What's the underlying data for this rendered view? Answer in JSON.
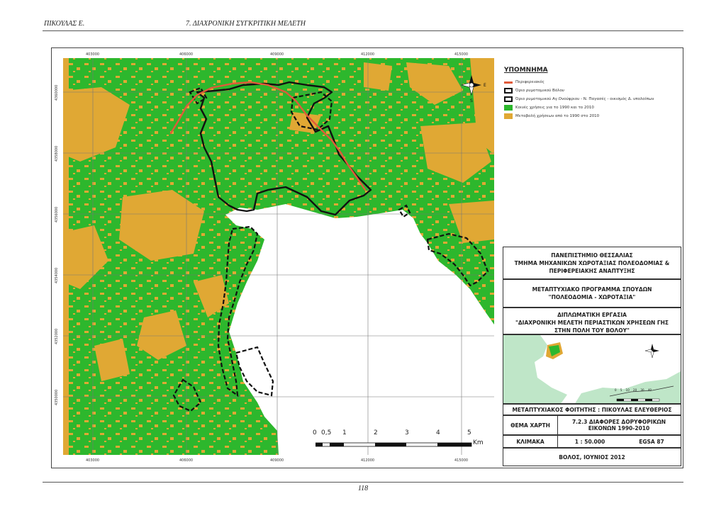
{
  "header": {
    "author": "ΠΙΚΟΥΛΑΣ Ε.",
    "chapter": "7. ΔΙΑΧΡΟΝΙΚΗ ΣΥΓΚΡΙΤΙΚΗ ΜΕΛΕΤΗ"
  },
  "footer": {
    "page_number": "118"
  },
  "map": {
    "x_ticks": [
      "403000",
      "406000",
      "409000",
      "412000",
      "415000"
    ],
    "y_ticks": [
      "4360000",
      "4358000",
      "4356000",
      "4354000",
      "4352000",
      "4350000"
    ],
    "colors": {
      "unchanged": "#2db72d",
      "changed": "#e0a834",
      "road": "#e05a3a",
      "boundary": "#111111",
      "sea": "#ffffff"
    }
  },
  "legend": {
    "title": "ΥΠΟΜΝΗΜΑ",
    "items": [
      {
        "label": "Περιφερειακός",
        "symbol": "line-red"
      },
      {
        "label": "Όριο ρυμοτομικού Βόλου",
        "symbol": "line-black"
      },
      {
        "label": "Όριο ρυμοτομικού Αγ.Ονούφριου - Ν. Παγασές - οικισμός Δ. υπολοίπων",
        "symbol": "dashed-black"
      },
      {
        "label": "Κοινές χρήσεις για το 1990 και το 2010",
        "symbol": "fill-green"
      },
      {
        "label": "Μεταβολή χρήσεων από το 1990 στο 2010",
        "symbol": "fill-orange"
      }
    ]
  },
  "north_arrow": {
    "n": "N",
    "e": "E",
    "s": "S",
    "w": "W"
  },
  "title_block": {
    "university": [
      "ΠΑΝΕΠΙΣΤΗΜΙΟ ΘΕΣΣΑΛΙΑΣ",
      "ΤΜΗΜΑ ΜΗΧΑΝΙΚΩΝ ΧΩΡΟΤΑΞΙΑΣ ΠΟΛΕΟΔΟΜΙΑΣ &",
      "ΠΕΡΙΦΕΡΕΙΑΚΗΣ ΑΝΑΠΤΥΞΗΣ"
    ],
    "program": [
      "ΜΕΤΑΠΤΥΧΙΑΚΟ ΠΡΟΓΡΑΜΜΑ ΣΠΟΥΔΩΝ",
      "\"ΠΟΛΕΟΔΟΜΙΑ - ΧΩΡΟΤΑΞΙΑ\""
    ],
    "thesis": [
      "ΔΙΠΛΩΜΑΤΙΚΗ ΕΡΓΑΣΙΑ",
      "\"ΔΙΑΧΡΟΝΙΚΗ ΜΕΛΕΤΗ ΠΕΡΙΑΣΤΙΚΩΝ ΧΡΗΣΕΩΝ ΓΗΣ",
      "ΣΤΗΝ ΠΟΛΗ ΤΟΥ ΒΟΛΟΥ\""
    ],
    "student": "ΜΕΤΑΠΤΥΧΙΑΚΟΣ ΦΟΙΤΗΤΗΣ : ΠΙΚΟΥΛΑΣ ΕΛΕΥΘΕΡΙΟΣ",
    "map_theme_label": "ΘΕΜΑ ΧΑΡΤΗ",
    "map_theme_value": [
      "7.2.3 ΔΙΑΦΟΡΕΣ ΔΟΡΥΦΟΡΙΚΩΝ",
      "ΕΙΚΟΝΩΝ 1990-2010"
    ],
    "scale_label": "ΚΛΙΜΑΚΑ",
    "scale_value": "1 : 50.000",
    "projection": "EGSA 87",
    "place_date": "ΒΟΛΟΣ, ΙΟΥΝΙΟΣ 2012"
  },
  "inset": {
    "scale_labels": [
      "0",
      "5",
      "10",
      "20",
      "30",
      "40"
    ]
  },
  "scale_bar": {
    "labels": [
      "0",
      "0,5",
      "1",
      "2",
      "3",
      "4",
      "5"
    ],
    "unit": "Km"
  }
}
